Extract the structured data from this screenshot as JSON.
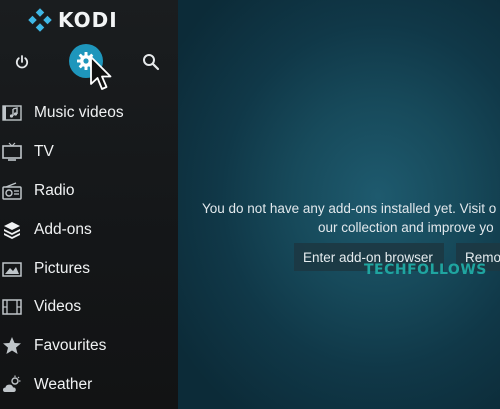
{
  "app": {
    "name": "KODI"
  },
  "top_buttons": {
    "power": "power-icon",
    "settings": "gear-icon",
    "search": "search-icon"
  },
  "menu": {
    "items": [
      {
        "label": "Music videos",
        "icon": "music-video-icon"
      },
      {
        "label": "TV",
        "icon": "tv-icon"
      },
      {
        "label": "Radio",
        "icon": "radio-icon"
      },
      {
        "label": "Add-ons",
        "icon": "addons-box-icon"
      },
      {
        "label": "Pictures",
        "icon": "picture-icon"
      },
      {
        "label": "Videos",
        "icon": "film-strip-icon"
      },
      {
        "label": "Favourites",
        "icon": "star-icon"
      },
      {
        "label": "Weather",
        "icon": "cloud-sun-icon"
      }
    ]
  },
  "main": {
    "message_line1": "You do not have any add-ons installed yet. Visit o",
    "message_line2": "our collection and improve yo",
    "buttons": {
      "browser": "Enter add-on browser",
      "remove": "Remo"
    }
  },
  "watermark": "TECHFOLLOWS",
  "colors": {
    "sidebar_bg": "#16191b",
    "main_bg": "#174a5b",
    "accent": "#1e96bc",
    "watermark": "#1fa5a0",
    "button_bg": "#1c3843"
  }
}
